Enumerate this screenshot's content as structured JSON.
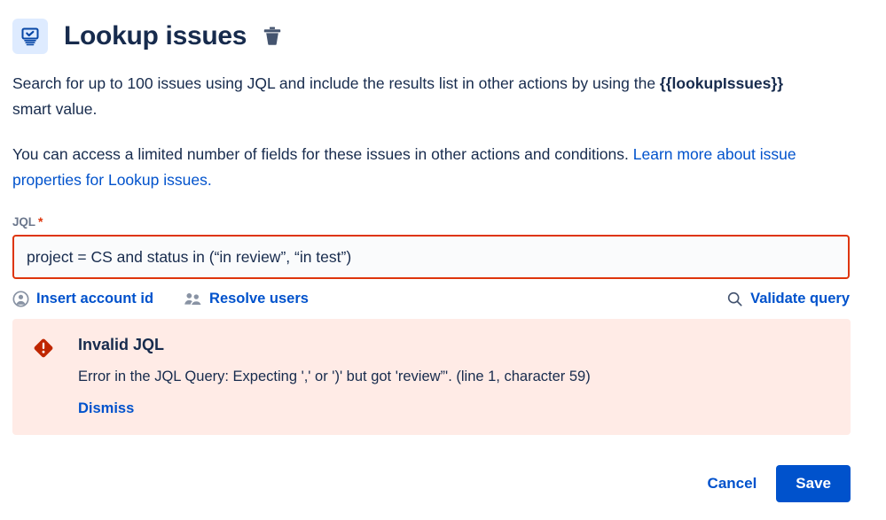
{
  "header": {
    "icon": "lookup-issues-screen-check-icon",
    "title": "Lookup issues",
    "delete_icon": "trash-icon",
    "icon_bg": "#DEEBFF",
    "icon_color": "#0747A6"
  },
  "description": {
    "paragraph1_before": "Search for up to 100 issues using JQL and include the results list in other actions by using the ",
    "paragraph1_smart_value": "{{lookupIssues}}",
    "paragraph1_after": " smart value.",
    "paragraph2_text": "You can access a limited number of fields for these issues in other actions and conditions. ",
    "paragraph2_link": "Learn more about issue properties for Lookup issues."
  },
  "jql_field": {
    "label": "JQL",
    "required_marker": "*",
    "value": "project = CS and status in (“in review”, “in test”)",
    "placeholder": "",
    "border_color": "#DE350B",
    "background": "#FAFBFC"
  },
  "actions": [
    {
      "icon": "person-icon",
      "label": "Insert account id"
    },
    {
      "icon": "people-group-icon",
      "label": "Resolve users"
    },
    {
      "icon": "search-icon",
      "label": "Validate query"
    }
  ],
  "error": {
    "icon": "error-diamond-icon",
    "icon_color": "#BF2600",
    "background": "#FFEBE6",
    "title": "Invalid JQL",
    "message": "Error in the JQL Query: Expecting ',' or ')' but got 'review”'. (line 1, character 59)",
    "dismiss_label": "Dismiss"
  },
  "footer": {
    "cancel_label": "Cancel",
    "save_label": "Save",
    "save_color": "#0052CC"
  }
}
